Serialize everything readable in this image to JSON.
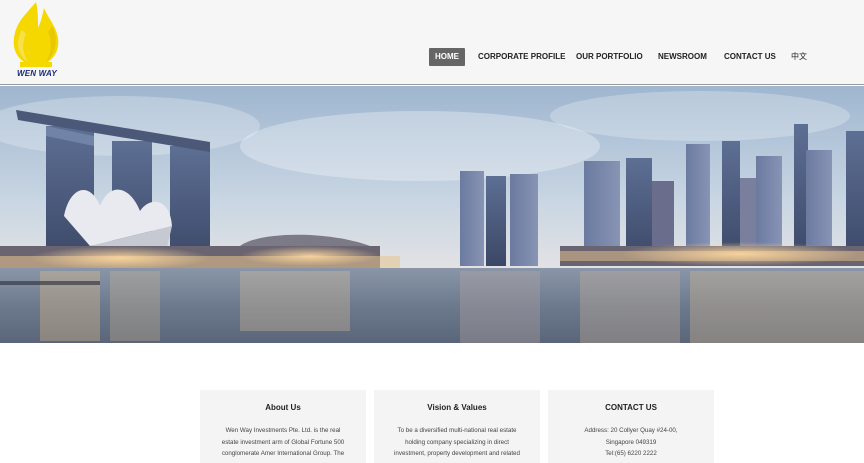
{
  "brand": {
    "name": "WEN WAY"
  },
  "nav": {
    "items": [
      {
        "label": "HOME",
        "active": true
      },
      {
        "label": "CORPORATE PROFILE",
        "active": false
      },
      {
        "label": "OUR PORTFOLIO",
        "active": false
      },
      {
        "label": "NEWSROOM",
        "active": false
      },
      {
        "label": "CONTACT US",
        "active": false
      },
      {
        "label": "中文",
        "active": false
      }
    ]
  },
  "colors": {
    "logo_flame": "#f5d800",
    "logo_text": "#1a2a7a",
    "nav_active_bg": "#666666",
    "card_bg": "#f4f4f4"
  },
  "cards": [
    {
      "title": "About Us",
      "lines": [
        "Wen Way Investments Pte. Ltd. is the real",
        "estate investment arm of Global Fortune 500",
        "conglomerate Amer International Group. The"
      ]
    },
    {
      "title": "Vision & Values",
      "lines": [
        "To be a diversified multi-national real estate",
        "holding company specializing in direct",
        "investment, property development and related"
      ]
    },
    {
      "title": "CONTACT US",
      "lines": [
        "Address: 20 Collyer Quay #24-00,",
        "Singapore 049319",
        "Tel:(65) 6220 2222"
      ]
    }
  ]
}
